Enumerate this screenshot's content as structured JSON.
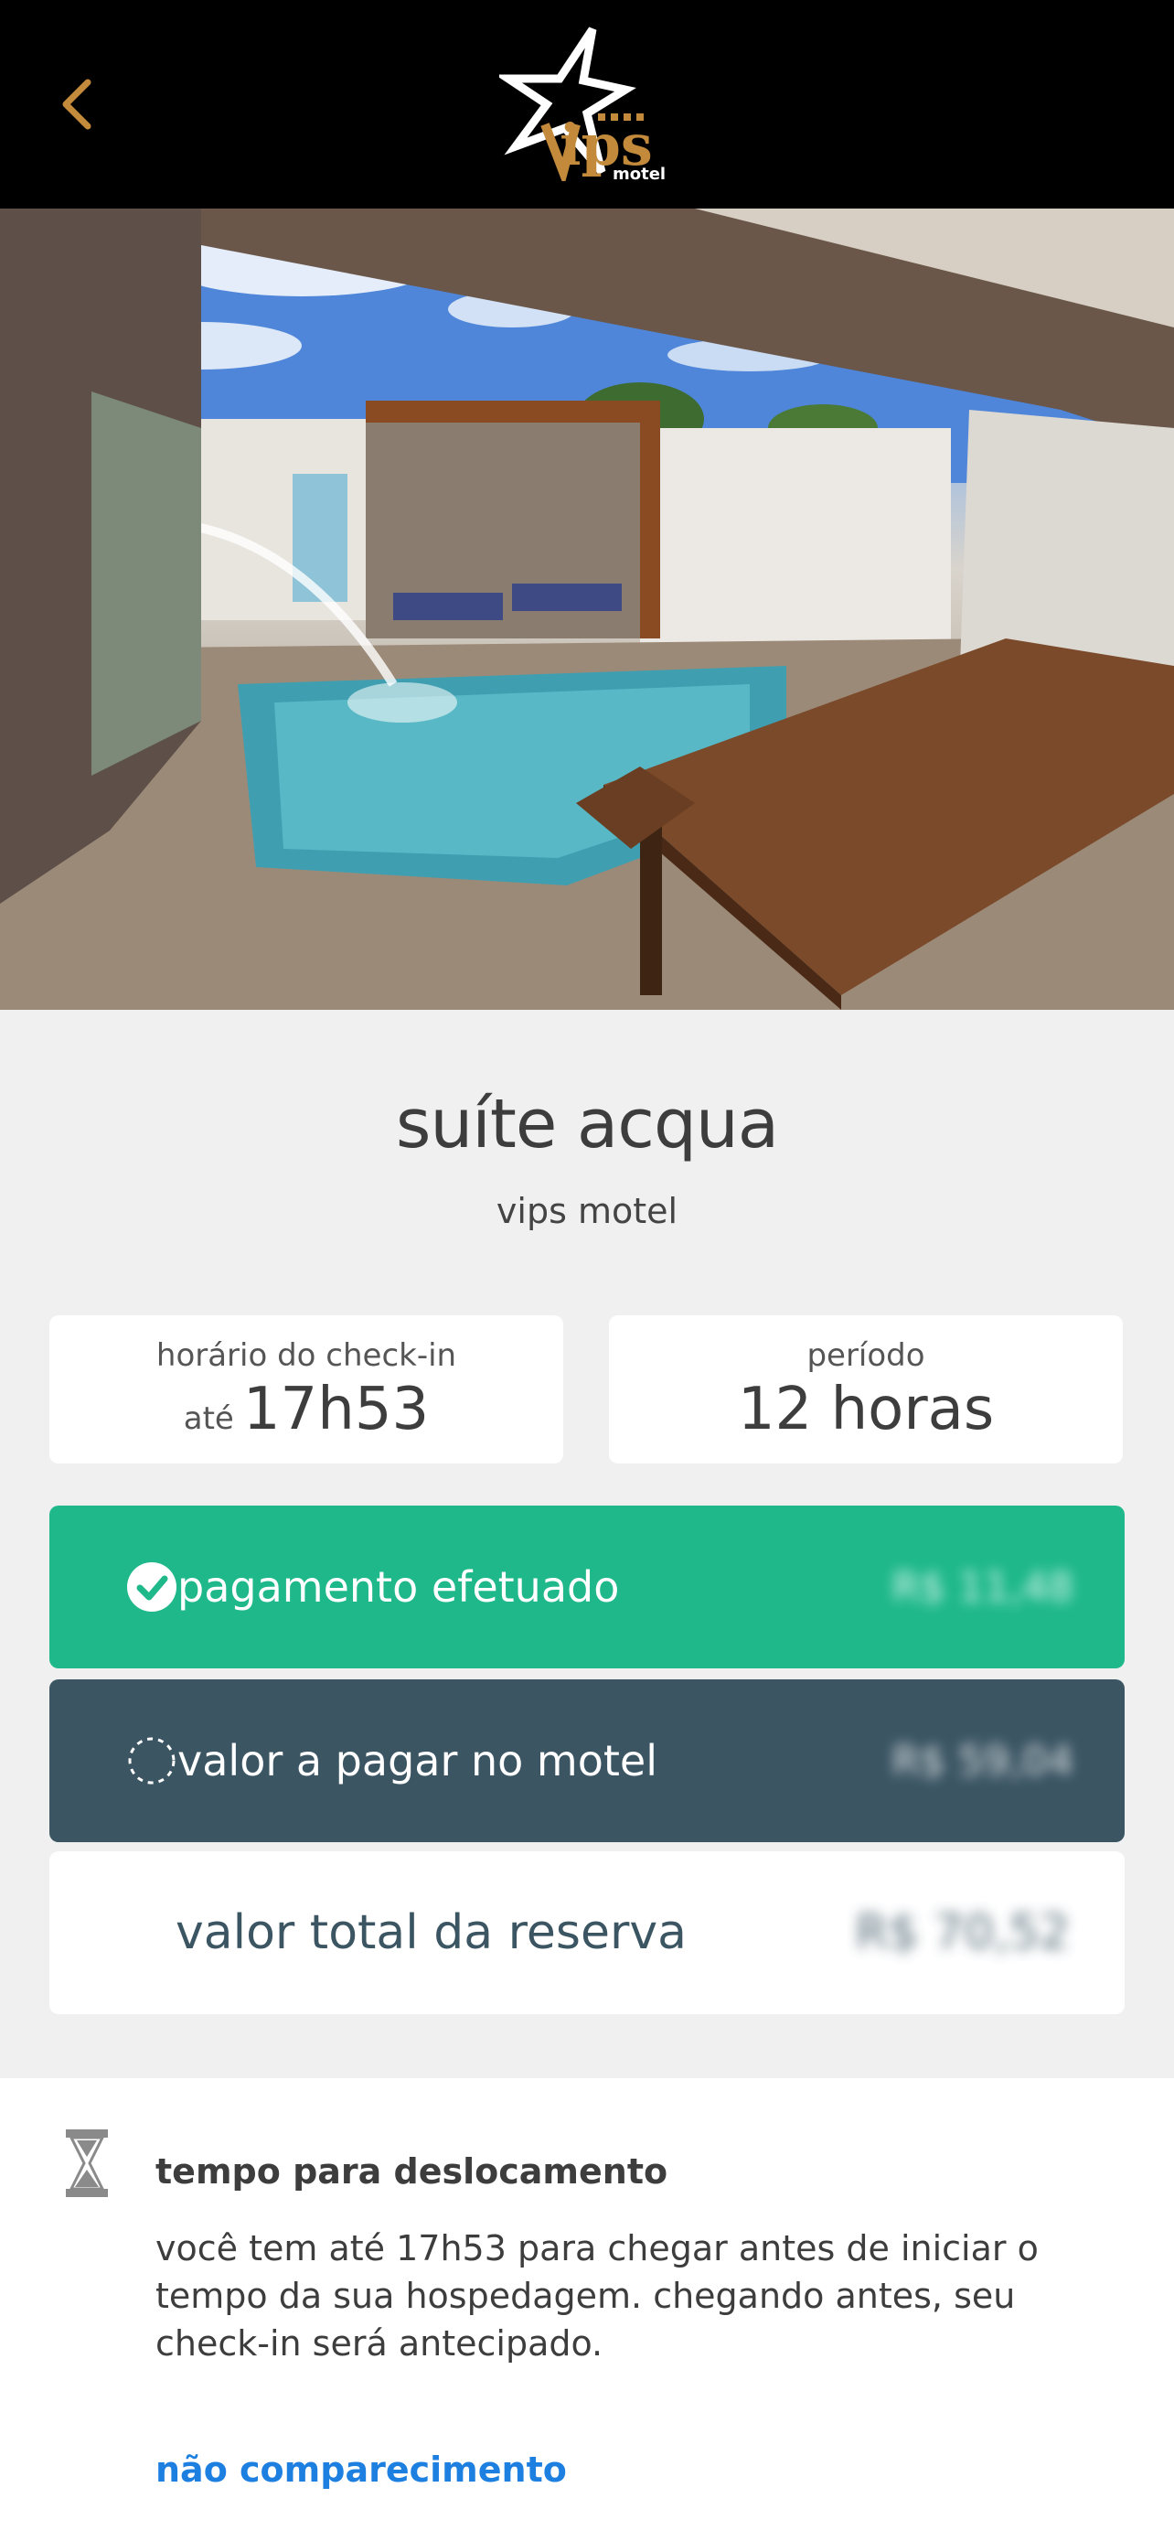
{
  "header": {
    "back_icon": "chevron-left-icon",
    "logo_text": "Vips",
    "logo_sub": "motel",
    "accent": "#c28a3a"
  },
  "suite": {
    "title": "suíte acqua",
    "subtitle": "vips motel"
  },
  "checkin": {
    "label": "horário do check-in",
    "prefix": "até",
    "value": "17h53"
  },
  "period": {
    "label": "período",
    "value": "12 horas"
  },
  "payments": {
    "paid": {
      "label": "pagamento efetuado",
      "amount": "R$ 11,48",
      "icon": "check-circle-icon",
      "color": "#1eb88a"
    },
    "due": {
      "label": "valor a pagar no motel",
      "amount": "R$ 59,04",
      "icon": "dashed-circle-icon",
      "color": "#3b5563"
    },
    "total": {
      "label": "valor total da reserva",
      "amount": "R$ 70,52"
    }
  },
  "travel": {
    "icon": "hourglass-icon",
    "title": "tempo para deslocamento",
    "text": "você tem até 17h53 para chegar antes de iniciar o tempo da sua hospedagem. chegando antes, seu check-in será antecipado.",
    "link": "não comparecimento"
  }
}
